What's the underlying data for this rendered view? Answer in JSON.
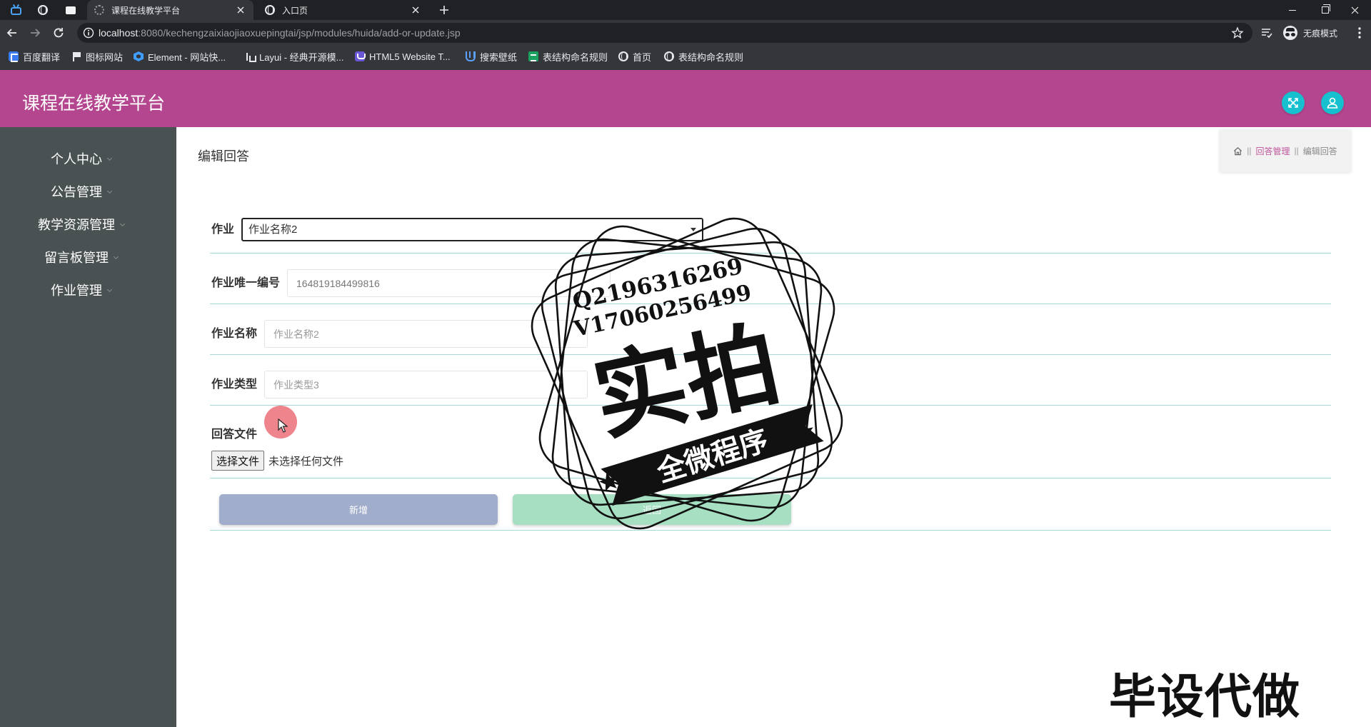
{
  "browser": {
    "tabs": [
      {
        "title": "课程在线教学平台",
        "icon": "app-favicon-icon",
        "active": true
      },
      {
        "title": "入口页",
        "icon": "globe-icon",
        "active": false
      }
    ],
    "url": {
      "host": "localhost",
      "path": ":8080/kechengzaixiaojiaoxuepingtai/jsp/modules/huida/add-or-update.jsp"
    },
    "profile_label": "无痕模式",
    "bookmarks": [
      {
        "label": "百度翻译",
        "icon": "translate-icon"
      },
      {
        "label": "图标网站",
        "icon": "flag-icon"
      },
      {
        "label": "Element - 网站快...",
        "icon": "element-icon"
      },
      {
        "label": "Layui - 经典开源模...",
        "icon": "layui-icon"
      },
      {
        "label": "HTML5 Website T...",
        "icon": "html5-icon"
      },
      {
        "label": "搜索壁纸",
        "icon": "wallpaper-icon"
      },
      {
        "label": "表结构命名规则",
        "icon": "sheet-icon"
      },
      {
        "label": "首页",
        "icon": "globe-icon"
      },
      {
        "label": "表结构命名规则",
        "icon": "globe-icon"
      }
    ]
  },
  "app": {
    "title": "课程在线教学平台",
    "header_icons": [
      "fullscreen-icon",
      "user-icon"
    ]
  },
  "sidebar": {
    "items": [
      {
        "label": "个人中心"
      },
      {
        "label": "公告管理"
      },
      {
        "label": "教学资源管理"
      },
      {
        "label": "留言板管理"
      },
      {
        "label": "作业管理"
      }
    ]
  },
  "page": {
    "title": "编辑回答",
    "breadcrumb": {
      "separator": "||",
      "section": "回答管理",
      "current": "编辑回答"
    }
  },
  "form": {
    "homework": {
      "label": "作业",
      "value": "作业名称2"
    },
    "homework_id": {
      "label": "作业唯一编号",
      "value": "164819184499816"
    },
    "homework_name": {
      "label": "作业名称",
      "value": "作业名称2"
    },
    "homework_type": {
      "label": "作业类型",
      "value": "作业类型3"
    },
    "answer_file": {
      "label": "回答文件",
      "button": "选择文件",
      "status": "未选择任何文件"
    },
    "submit_label": "新增",
    "back_label": "返回"
  },
  "watermark": {
    "qq": "Q2196316269",
    "wechat": "V17060256499",
    "main": "实拍",
    "ribbon": "全微程序",
    "corner": "毕设代做"
  },
  "theme": {
    "header": "#b4468f",
    "sidebar": "#495152",
    "link": "#c0579c",
    "divider": "#a6d8d8",
    "submit": "#a1aecb",
    "back": "#a7dfc2",
    "circle": "#17c0cf"
  }
}
